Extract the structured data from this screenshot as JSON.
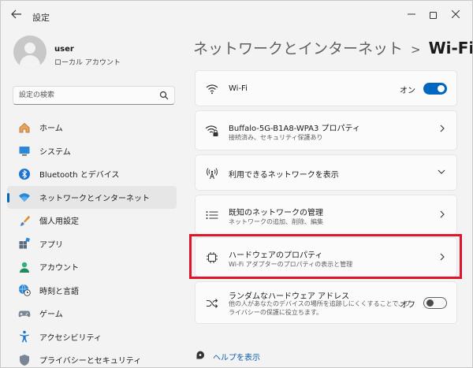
{
  "window": {
    "title": "設定"
  },
  "profile": {
    "name": "user",
    "account_type": "ローカル アカウント"
  },
  "search": {
    "placeholder": "設定の検索"
  },
  "sidebar": {
    "items": [
      {
        "label": "ホーム",
        "icon": "home-icon"
      },
      {
        "label": "システム",
        "icon": "system-icon"
      },
      {
        "label": "Bluetooth とデバイス",
        "icon": "bluetooth-icon"
      },
      {
        "label": "ネットワークとインターネット",
        "icon": "wifi-icon",
        "active": true
      },
      {
        "label": "個人用設定",
        "icon": "paintbrush-icon"
      },
      {
        "label": "アプリ",
        "icon": "apps-icon"
      },
      {
        "label": "アカウント",
        "icon": "account-icon"
      },
      {
        "label": "時刻と言語",
        "icon": "globe-clock-icon"
      },
      {
        "label": "ゲーム",
        "icon": "gamepad-icon"
      },
      {
        "label": "アクセシビリティ",
        "icon": "accessibility-icon"
      },
      {
        "label": "プライバシーとセキュリティ",
        "icon": "shield-icon"
      }
    ]
  },
  "breadcrumb": {
    "parent": "ネットワークとインターネット",
    "separator": ">",
    "current": "Wi-Fi"
  },
  "cards": {
    "wifi": {
      "title": "Wi-Fi",
      "state": "オン",
      "icon": "wifi-icon"
    },
    "connected": {
      "title": "Buffalo-5G-B1A8-WPA3 プロパティ",
      "subtitle": "接続済み、セキュリティ保護あり",
      "icon": "wifi-lock-icon"
    },
    "available": {
      "title": "利用できるネットワークを表示",
      "icon": "antenna-icon"
    },
    "known": {
      "title": "既知のネットワークの管理",
      "subtitle": "ネットワークの追加、削除、編集",
      "icon": "list-icon"
    },
    "hardware": {
      "title": "ハードウェアのプロパティ",
      "subtitle": "Wi-Fi アダプターのプロパティの表示と管理",
      "icon": "chip-icon"
    },
    "random": {
      "title": "ランダムなハードウェア アドレス",
      "subtitle_line1": "他の人があなたのデバイスの場所を追跡しにくくすることで、プ",
      "subtitle_line2": "ライバシーの保護に役立ちます。",
      "state": "オフ",
      "icon": "shuffle-icon"
    }
  },
  "help": {
    "label": "ヘルプを表示"
  },
  "colors": {
    "accent": "#0067c0",
    "highlight": "#e0142a"
  }
}
